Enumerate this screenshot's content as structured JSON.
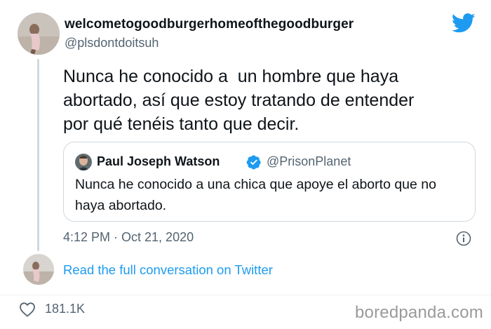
{
  "author": {
    "display_name": "welcometogoodburgerhomeofthegoodburger",
    "handle": "@plsdontdoitsuh",
    "avatar_icon": "user-photo-avatar"
  },
  "tweet": {
    "text": "Nunca he conocido a  un hombre que haya\nabortado, así que estoy tratando de entender\npor qué tenéis tanto que decir.",
    "timestamp": "4:12 PM · Oct 21, 2020"
  },
  "quoted_tweet": {
    "display_name": "Paul Joseph Watson",
    "handle": "@PrisonPlanet",
    "verified": true,
    "text": "Nunca he conocido a una chica que apoye el aborto que no haya abortado."
  },
  "actions": {
    "read_more": "Read the full conversation on Twitter",
    "likes": "181.1K"
  },
  "watermark": "boredpanda.com",
  "colors": {
    "twitter_blue": "#1d9bf0",
    "text_primary": "#0f1419",
    "text_secondary": "#536471",
    "border": "#cfd9de",
    "watermark": "#9a9a9a"
  }
}
